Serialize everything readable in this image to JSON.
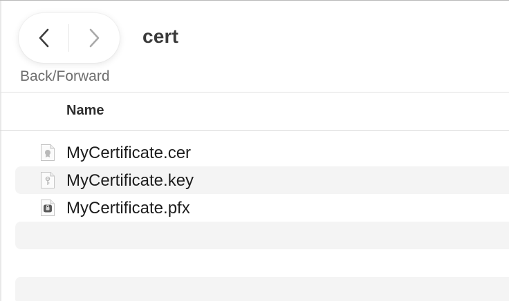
{
  "toolbar": {
    "back_icon": "chevron-left-icon",
    "forward_icon": "chevron-right-icon",
    "nav_caption": "Back/Forward",
    "title": "cert"
  },
  "columns": {
    "name": "Name"
  },
  "files": [
    {
      "name": "MyCertificate.cer",
      "icon": "certificate-file-icon"
    },
    {
      "name": "MyCertificate.key",
      "icon": "key-file-icon"
    },
    {
      "name": "MyCertificate.pfx",
      "icon": "pfx-file-icon"
    }
  ],
  "colors": {
    "title": "#3a3a3a",
    "alt_row": "#f4f4f4",
    "text": "#1d1d1d",
    "caption": "#6e6e6e"
  }
}
